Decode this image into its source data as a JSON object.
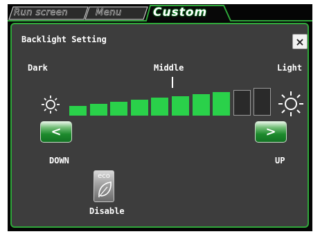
{
  "tabs": [
    {
      "label": "Run screen",
      "active": false
    },
    {
      "label": "Menu",
      "active": false
    },
    {
      "label": "Custom",
      "active": true
    }
  ],
  "panel": {
    "title": "Backlight Setting",
    "close_label": "×"
  },
  "scale": {
    "left_label": "Dark",
    "middle_label": "Middle",
    "right_label": "Light",
    "total_steps": 10,
    "current_level": 8
  },
  "buttons": {
    "down_glyph": "<",
    "down_label": "DOWN",
    "up_glyph": ">",
    "up_label": "UP",
    "eco_text": "eco",
    "eco_label": "Disable"
  },
  "colors": {
    "accent": "#2fa73a",
    "bar_on": "#2ad14a",
    "bar_off": "#2a2a2a",
    "panel_bg": "#3d3d3d"
  }
}
